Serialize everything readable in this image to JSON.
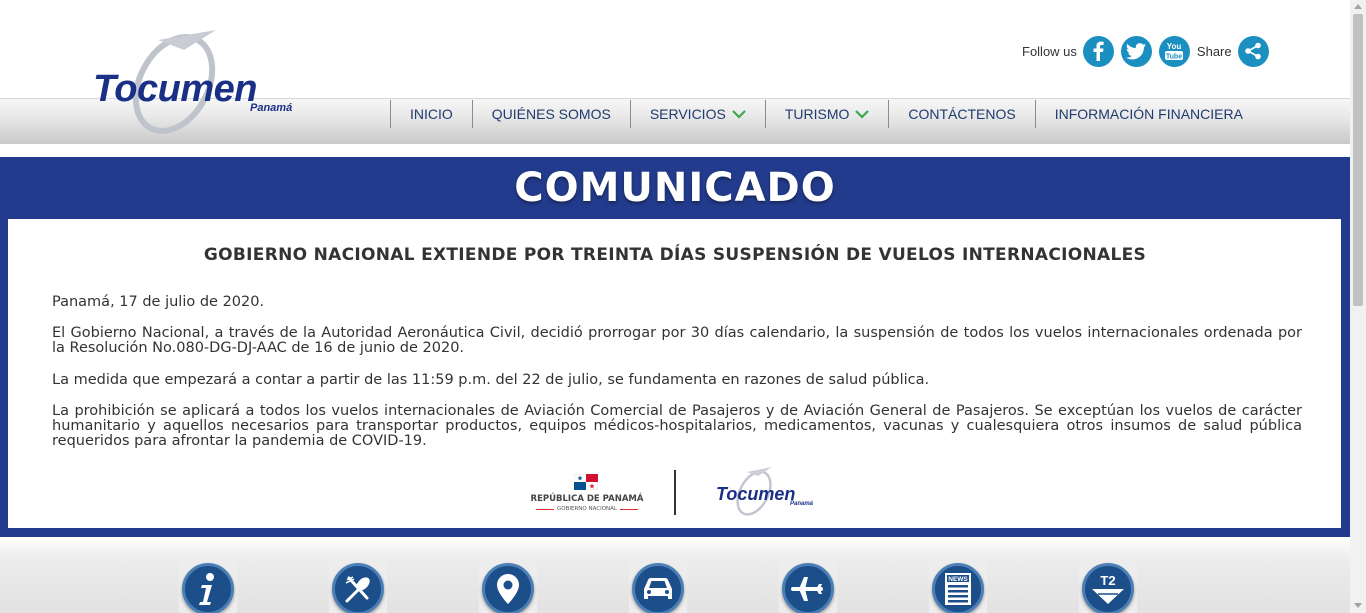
{
  "brand": {
    "name": "Tocumen",
    "sub": "Panamá"
  },
  "social": {
    "follow_label": "Follow us",
    "share_label": "Share",
    "icons": [
      "facebook-icon",
      "twitter-icon",
      "youtube-icon",
      "share-icon"
    ],
    "youtube_text": "You Tube",
    "accent": "#1b8fc0"
  },
  "nav": {
    "items": [
      {
        "label": "INICIO",
        "dropdown": false
      },
      {
        "label": "QUIÉNES SOMOS",
        "dropdown": false
      },
      {
        "label": "SERVICIOS",
        "dropdown": true
      },
      {
        "label": "TURISMO",
        "dropdown": true
      },
      {
        "label": "CONTÁCTENOS",
        "dropdown": false
      },
      {
        "label": "INFORMACIÓN FINANCIERA",
        "dropdown": false
      }
    ],
    "chevron_color": "#3aa84a"
  },
  "notice": {
    "banner_title": "COMUNICADO",
    "heading": "GOBIERNO NACIONAL EXTIENDE POR TREINTA DÍAS SUSPENSIÓN DE VUELOS INTERNACIONALES",
    "paragraphs": [
      "Panamá, 17 de julio de 2020.",
      "El Gobierno Nacional, a través de la Autoridad Aeronáutica Civil, decidió prorrogar por 30 días calendario, la suspensión de todos los vuelos internacionales ordenada por la Resolución No.080-DG-DJ-AAC de 16 de junio de 2020.",
      "La medida que empezará a contar a partir de las 11:59 p.m. del 22 de julio, se fundamenta en razones de salud pública.",
      "La prohibición se aplicará a todos los vuelos internacionales de Aviación Comercial de Pasajeros y de Aviación General de Pasajeros. Se exceptúan los vuelos de carácter humanitario y aquellos necesarios para transportar productos, equipos médicos-hospitalarios, medicamentos, vacunas y cualesquiera otros insumos de salud pública requeridos para afrontar la pandemia de COVID-19."
    ],
    "footer": {
      "republic": "REPÚBLICA DE PANAMÁ",
      "gobierno": "GOBIERNO NACIONAL",
      "logo_name": "Tocumen",
      "logo_sub": "Panamá"
    },
    "banner_color": "#233b8c"
  },
  "quick_links": {
    "icons": [
      "info-icon",
      "dining-icon",
      "location-icon",
      "car-icon",
      "airplane-icon",
      "news-icon",
      "t2-icon"
    ],
    "news_text": "NEWS",
    "t2_text": "T2"
  }
}
